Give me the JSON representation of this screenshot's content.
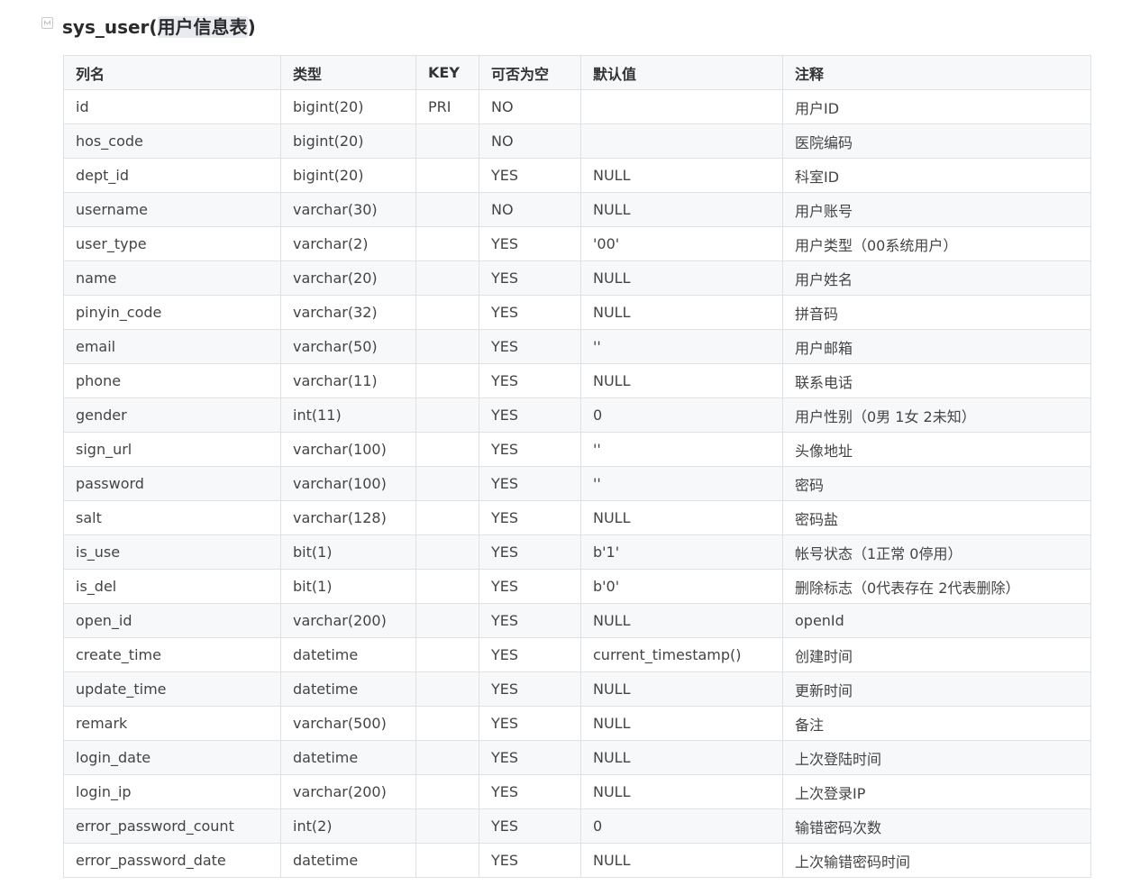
{
  "heading": {
    "prefix": "sys_user(",
    "highlight": "用户信息表",
    "suffix": ")"
  },
  "table": {
    "headers": [
      "列名",
      "类型",
      "KEY",
      "可否为空",
      "默认值",
      "注释"
    ],
    "rows": [
      [
        "id",
        "bigint(20)",
        "PRI",
        "NO",
        "",
        "用户ID"
      ],
      [
        "hos_code",
        "bigint(20)",
        "",
        "NO",
        "",
        "医院编码"
      ],
      [
        "dept_id",
        "bigint(20)",
        "",
        "YES",
        "NULL",
        "科室ID"
      ],
      [
        "username",
        "varchar(30)",
        "",
        "NO",
        "NULL",
        "用户账号"
      ],
      [
        "user_type",
        "varchar(2)",
        "",
        "YES",
        "'00'",
        "用户类型（00系统用户）"
      ],
      [
        "name",
        "varchar(20)",
        "",
        "YES",
        "NULL",
        "用户姓名"
      ],
      [
        "pinyin_code",
        "varchar(32)",
        "",
        "YES",
        "NULL",
        "拼音码"
      ],
      [
        "email",
        "varchar(50)",
        "",
        "YES",
        "''",
        "用户邮箱"
      ],
      [
        "phone",
        "varchar(11)",
        "",
        "YES",
        "NULL",
        "联系电话"
      ],
      [
        "gender",
        "int(11)",
        "",
        "YES",
        "0",
        "用户性别（0男 1女 2未知）"
      ],
      [
        "sign_url",
        "varchar(100)",
        "",
        "YES",
        "''",
        "头像地址"
      ],
      [
        "password",
        "varchar(100)",
        "",
        "YES",
        "''",
        "密码"
      ],
      [
        "salt",
        "varchar(128)",
        "",
        "YES",
        "NULL",
        "密码盐"
      ],
      [
        "is_use",
        "bit(1)",
        "",
        "YES",
        "b'1'",
        "帐号状态（1正常 0停用）"
      ],
      [
        "is_del",
        "bit(1)",
        "",
        "YES",
        "b'0'",
        "删除标志（0代表存在 2代表删除）"
      ],
      [
        "open_id",
        "varchar(200)",
        "",
        "YES",
        "NULL",
        "openId"
      ],
      [
        "create_time",
        "datetime",
        "",
        "YES",
        "current_timestamp()",
        "创建时间"
      ],
      [
        "update_time",
        "datetime",
        "",
        "YES",
        "NULL",
        "更新时间"
      ],
      [
        "remark",
        "varchar(500)",
        "",
        "YES",
        "NULL",
        "备注"
      ],
      [
        "login_date",
        "datetime",
        "",
        "YES",
        "NULL",
        "上次登陆时间"
      ],
      [
        "login_ip",
        "varchar(200)",
        "",
        "YES",
        "NULL",
        "上次登录IP"
      ],
      [
        "error_password_count",
        "int(2)",
        "",
        "YES",
        "0",
        "输错密码次数"
      ],
      [
        "error_password_date",
        "datetime",
        "",
        "YES",
        "NULL",
        "上次输错密码时间"
      ]
    ]
  }
}
